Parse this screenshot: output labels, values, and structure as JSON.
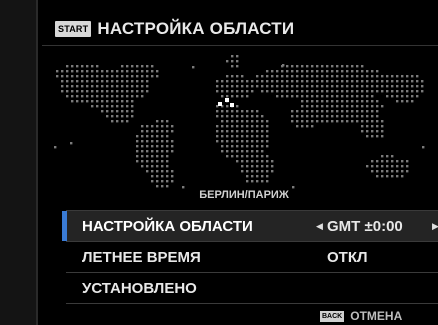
{
  "header": {
    "badge": "START",
    "title": "НАСТРОЙКА ОБЛАСТИ"
  },
  "map": {
    "city": "БЕРЛИН/ПАРИЖ",
    "dot_color": "#7a7a7a",
    "highlight_color": "#ffffff"
  },
  "menu": {
    "items": [
      {
        "label": "НАСТРОЙКА ОБЛАСТИ",
        "value": "GMT ±0:00",
        "selected": true
      },
      {
        "label": "ЛЕТНЕЕ ВРЕМЯ",
        "value": "ОТКЛ",
        "selected": false
      },
      {
        "label": "УСТАНОВЛЕНО",
        "value": "",
        "selected": false
      }
    ]
  },
  "footer": {
    "back_badge": "BACK",
    "cancel_label": "ОТМЕНА"
  },
  "colors": {
    "accent": "#3a7bd5",
    "selected_row": "#242424"
  }
}
